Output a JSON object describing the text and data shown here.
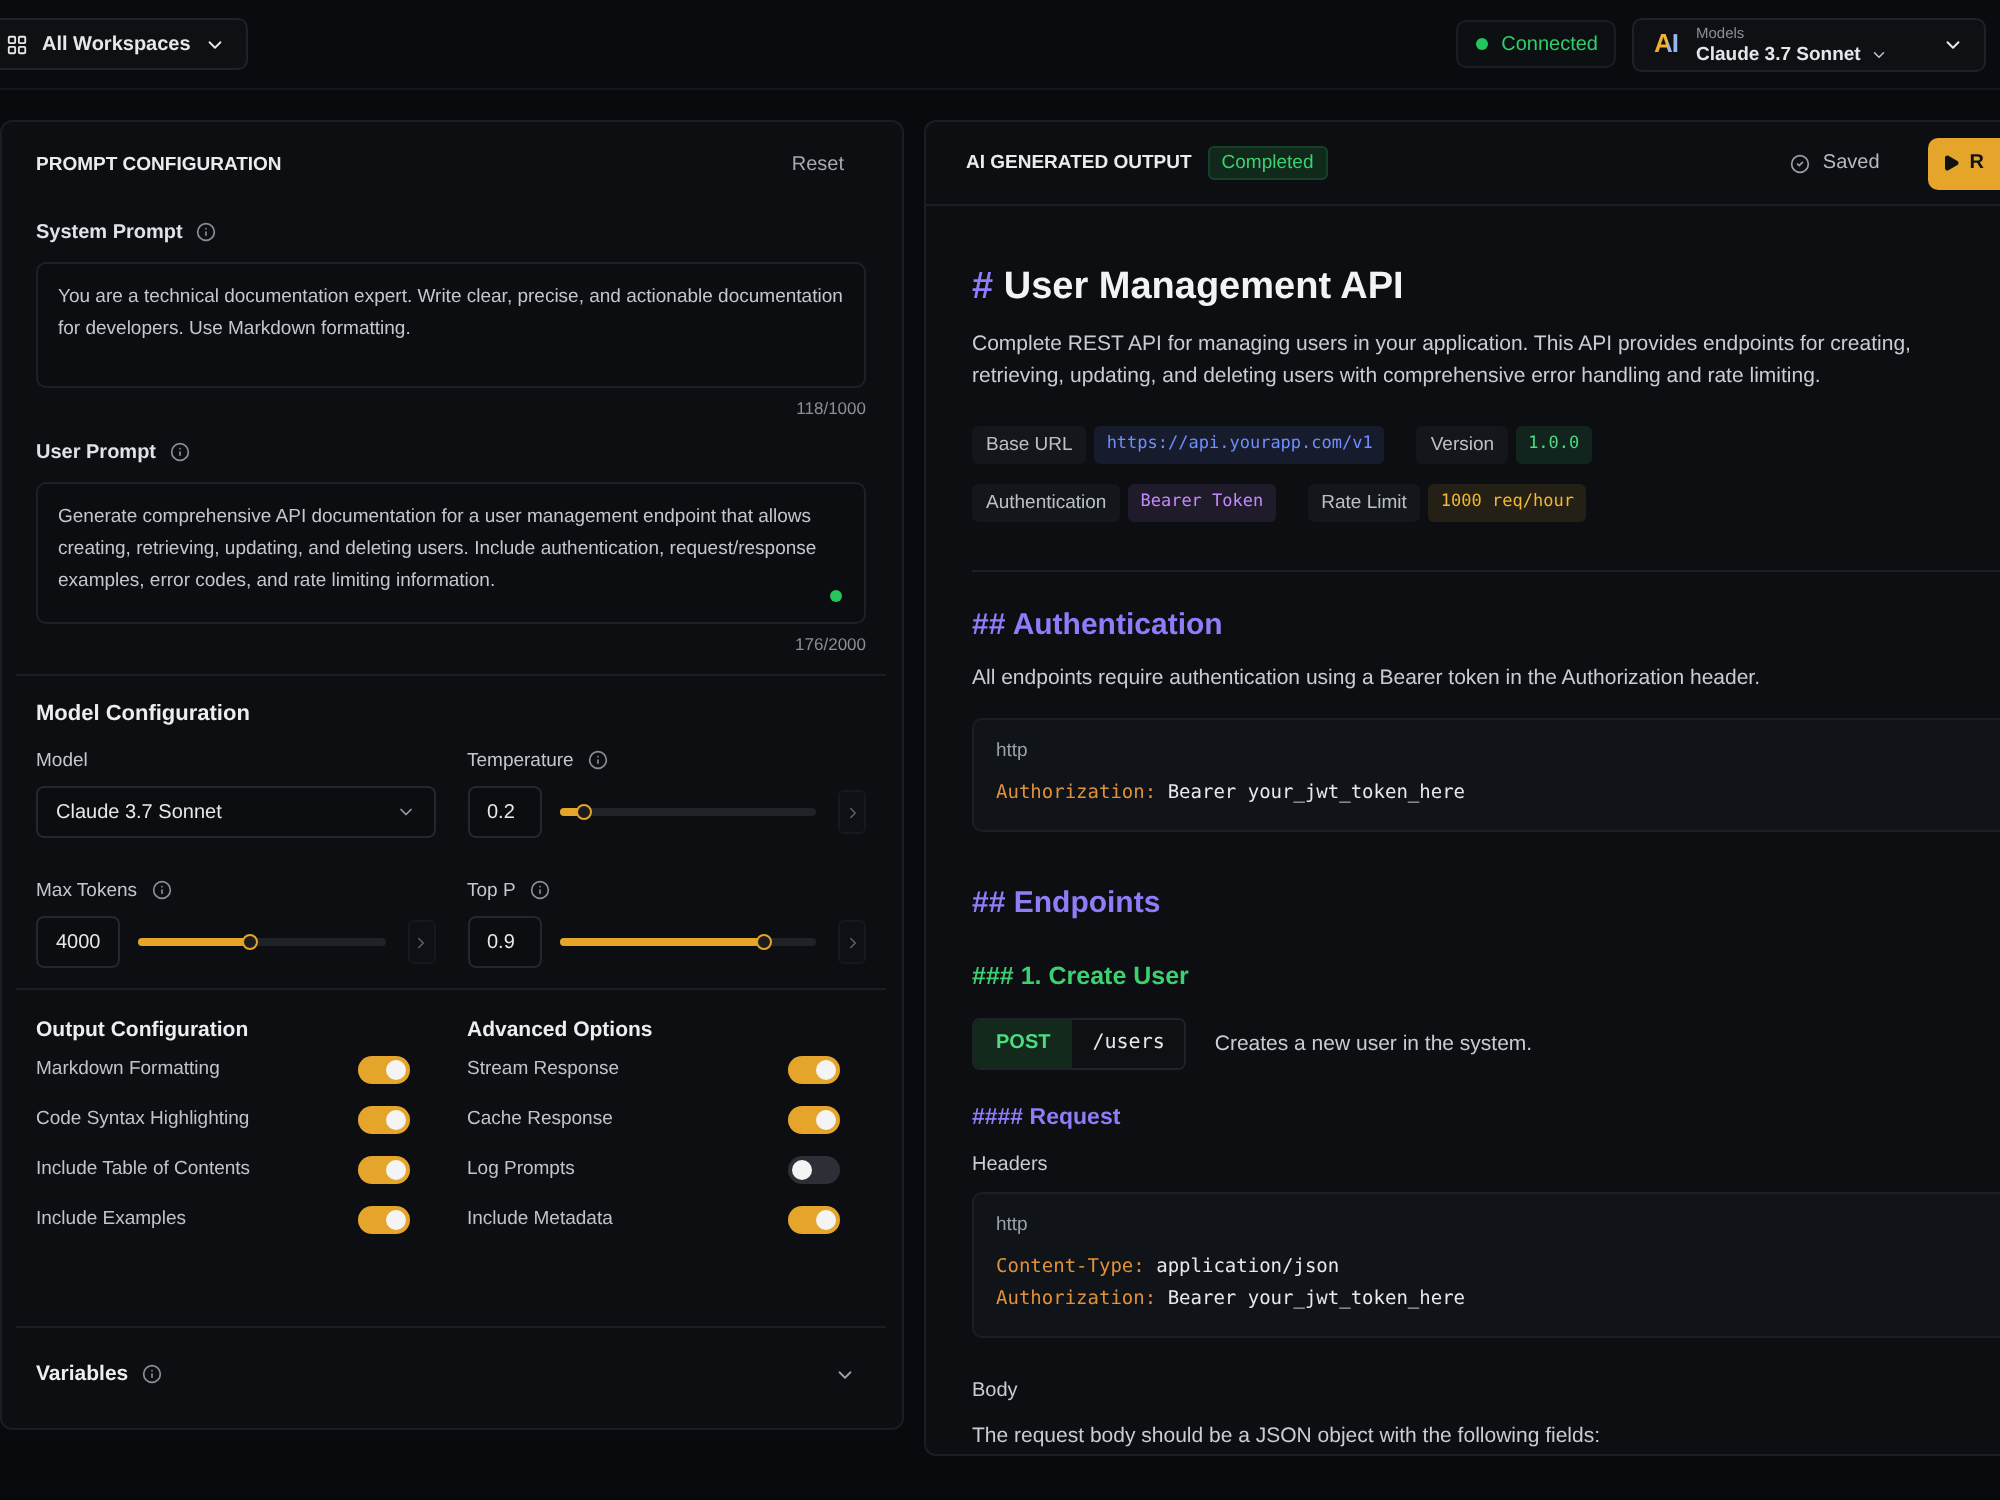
{
  "top_bar": {
    "workspace_button": {
      "label": "All Workspaces"
    },
    "connection": {
      "label": "Connected",
      "connected": true
    },
    "model_picker": {
      "logo": "AI",
      "caption": "Models",
      "value": "Claude 3.7 Sonnet"
    }
  },
  "prompt_panel": {
    "title": "PROMPT CONFIGURATION",
    "reset": "Reset",
    "prompts": [
      {
        "label": "System Prompt",
        "value": "You are a technical documentation expert. Write clear, precise, and actionable documentation for developers. Use Markdown formatting.",
        "counter": "118/1000",
        "active": false
      },
      {
        "label": "User Prompt",
        "value": "Generate comprehensive API documentation for a user management endpoint that allows creating, retrieving, updating, and deleting users. Include authentication, request/response examples, error codes, and rate limiting information.",
        "counter": "176/2000",
        "active": true
      }
    ],
    "model_config": {
      "title": "Model Configuration",
      "fields": [
        {
          "kind": "select",
          "label": "Model",
          "value": "Claude 3.7 Sonnet"
        },
        {
          "kind": "slider",
          "label": "Temperature",
          "value": "0.2",
          "level": 0.1
        },
        {
          "kind": "slider",
          "label": "Max Tokens",
          "value": "4000",
          "level": 0.45
        },
        {
          "kind": "slider",
          "label": "Top P",
          "value": "0.9",
          "level": 0.8
        }
      ]
    },
    "option_groups": [
      {
        "title": "Output Configuration",
        "options": [
          {
            "label": "Markdown Formatting",
            "on": true
          },
          {
            "label": "Code Syntax Highlighting",
            "on": true
          },
          {
            "label": "Include Table of Contents",
            "on": true
          },
          {
            "label": "Include Examples",
            "on": true
          }
        ]
      },
      {
        "title": "Advanced Options",
        "options": [
          {
            "label": "Stream Response",
            "on": true
          },
          {
            "label": "Cache Response",
            "on": true
          },
          {
            "label": "Log Prompts",
            "on": false
          },
          {
            "label": "Include Metadata",
            "on": true
          }
        ]
      }
    ],
    "variables": {
      "label": "Variables",
      "expanded": false
    }
  },
  "output_panel": {
    "title": "AI GENERATED OUTPUT",
    "status": "Completed",
    "saved": "Saved",
    "run_button": "R",
    "document": [
      {
        "kind": "h1",
        "marker": "#",
        "text": "User Management API"
      },
      {
        "kind": "paragraph",
        "text": "Complete REST API for managing users in your application. This API provides endpoints for creating, retrieving, updating, and deleting users with comprehensive error handling and rate limiting."
      },
      {
        "kind": "meta",
        "rows": [
          [
            {
              "label": "Base URL",
              "value": "https://api.yourapp.com/v1",
              "color": "#6f8fff"
            },
            {
              "label": "Version",
              "value": "1.0.0",
              "color": "#4ade80"
            }
          ],
          [
            {
              "label": "Authentication",
              "value": "Bearer Token",
              "color": "#c58af9"
            },
            {
              "label": "Rate Limit",
              "value": "1000 req/hour",
              "color": "#f2b733"
            }
          ]
        ]
      },
      {
        "kind": "rule"
      },
      {
        "kind": "h2",
        "marker": "##",
        "text": "Authentication"
      },
      {
        "kind": "paragraph",
        "text": "All endpoints require authentication using a Bearer token in the Authorization header."
      },
      {
        "kind": "code",
        "language": "http",
        "lines": [
          {
            "key": "Authorization:",
            "value": "Bearer your_jwt_token_here"
          }
        ]
      },
      {
        "kind": "h2",
        "marker": "##",
        "text": "Endpoints"
      },
      {
        "kind": "h3",
        "marker": "###",
        "text": "1. Create User"
      },
      {
        "kind": "endpoint",
        "method": "POST",
        "path": "/users",
        "description": "Creates a new user in the system."
      },
      {
        "kind": "h4",
        "marker": "####",
        "text": "Request"
      },
      {
        "kind": "label",
        "text": "Headers"
      },
      {
        "kind": "code",
        "language": "http",
        "lines": [
          {
            "key": "Content-Type:",
            "value": "application/json"
          },
          {
            "key": "Authorization:",
            "value": "Bearer your_jwt_token_here"
          }
        ]
      },
      {
        "kind": "label",
        "text": "Body"
      },
      {
        "kind": "paragraph",
        "text": "The request body should be a JSON object with the following fields:"
      }
    ]
  }
}
